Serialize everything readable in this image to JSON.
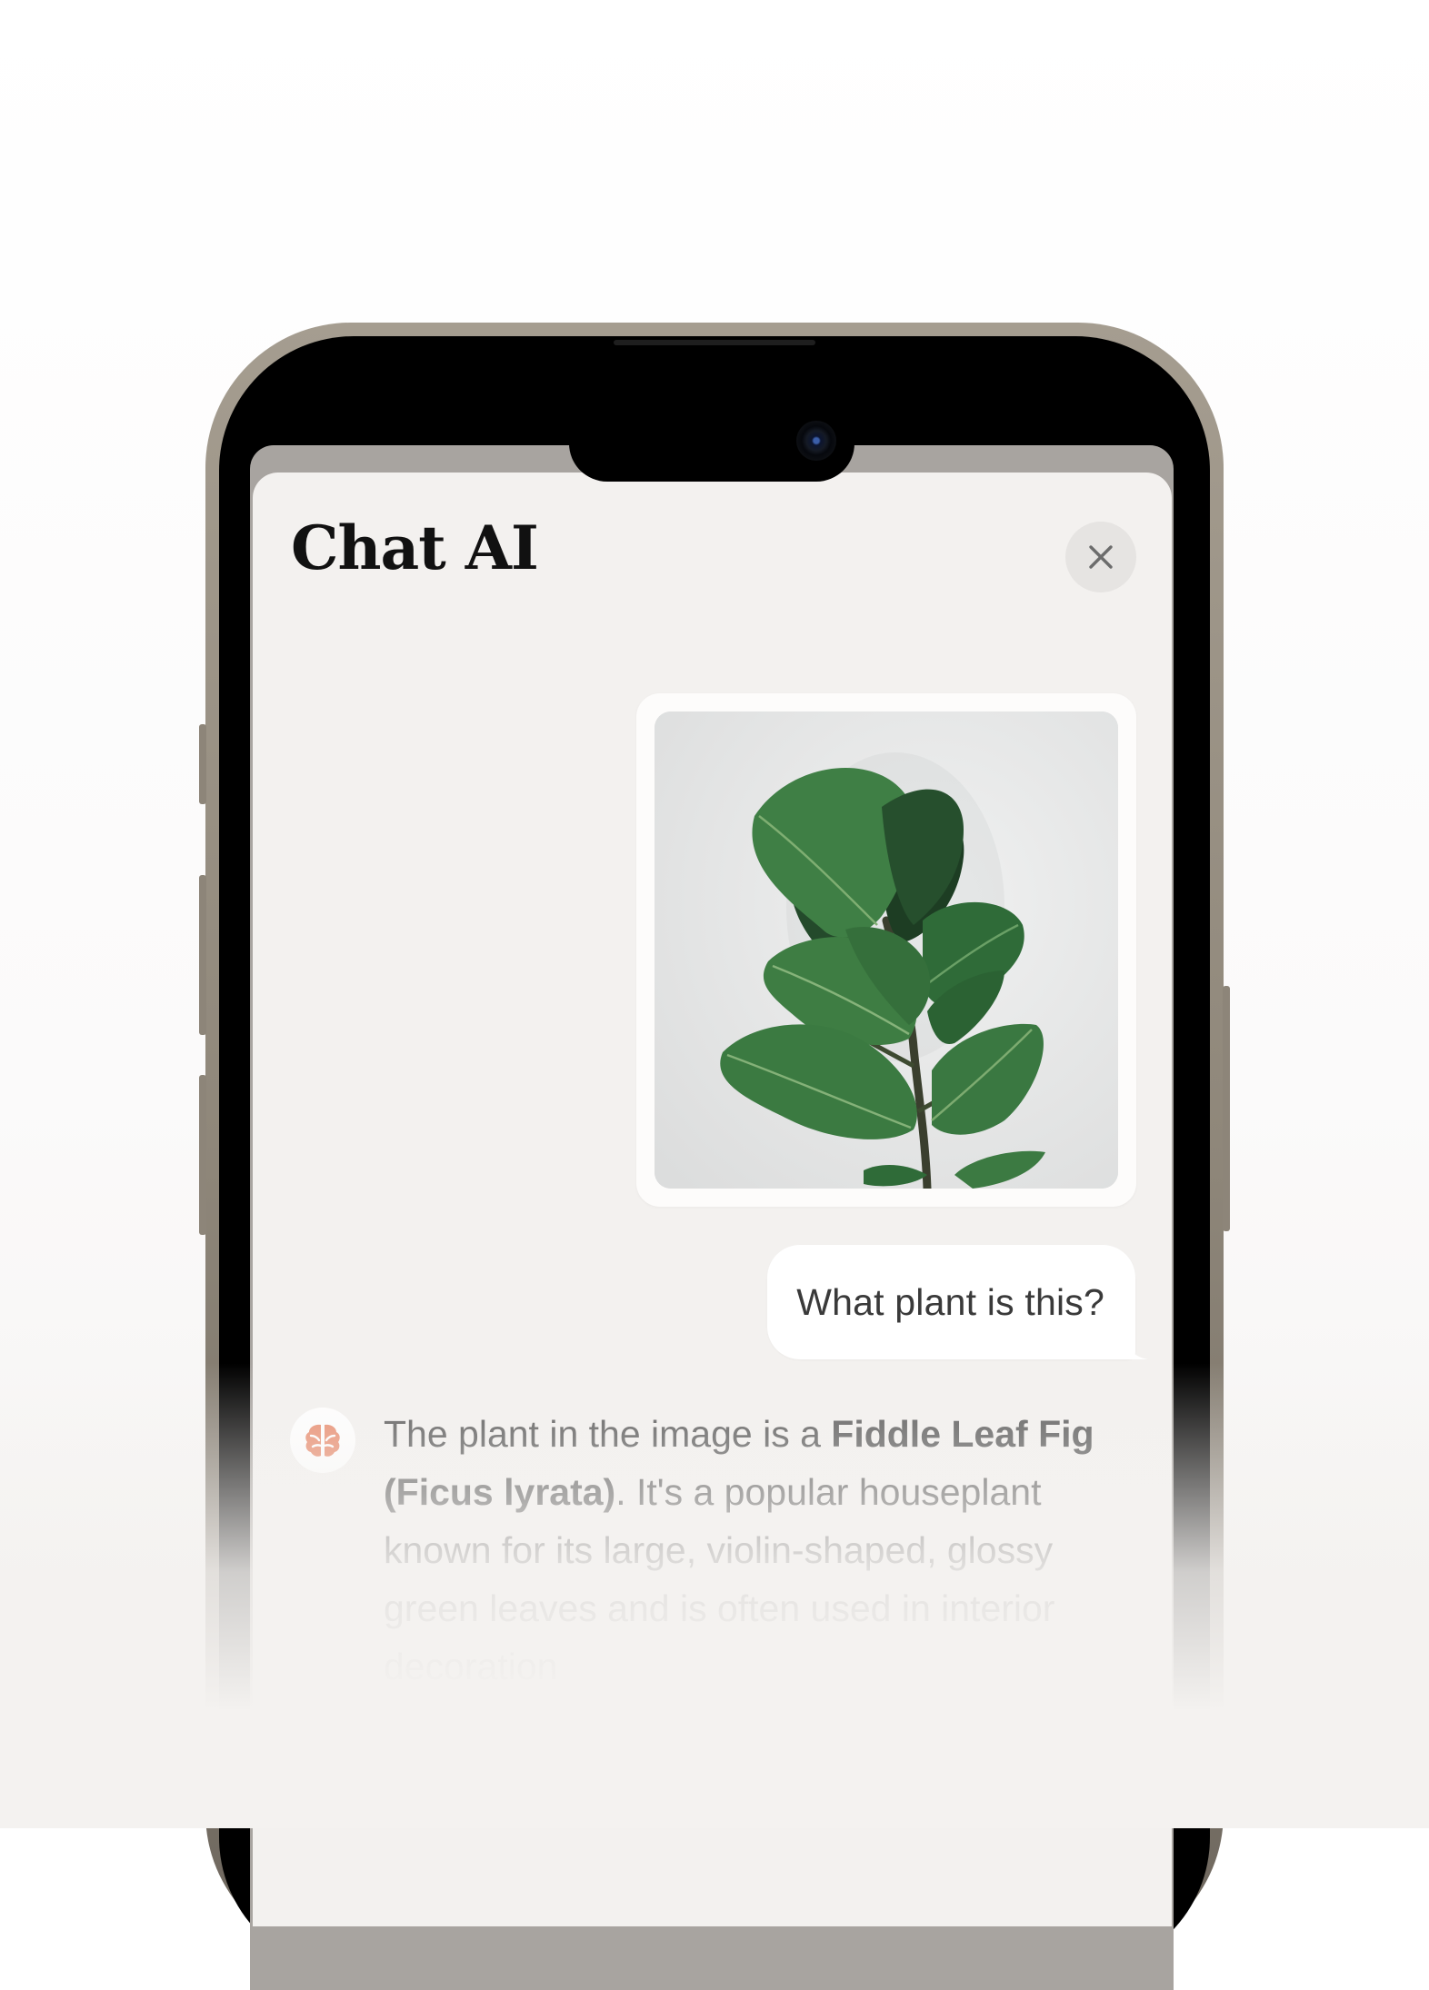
{
  "header": {
    "title": "Chat AI"
  },
  "icons": {
    "close": "close-icon",
    "assistant": "brain-icon",
    "camera": "front-camera"
  },
  "messages": [
    {
      "role": "user",
      "type": "image",
      "content": "fiddle-leaf-fig-photo"
    },
    {
      "role": "user",
      "type": "text",
      "text": "What plant is this?"
    },
    {
      "role": "assistant",
      "type": "text",
      "parts": [
        {
          "text": "The plant in the image is a "
        },
        {
          "text": "Fiddle Leaf Fig (Ficus lyrata)",
          "bold": true
        },
        {
          "text": ". It's a popular houseplant known for its large, violin-shaped, glossy green leaves and is often used in interior decoration"
        }
      ]
    }
  ],
  "colors": {
    "sheet_background": "#f3f1ef",
    "bubble_background": "#ffffff",
    "title_text": "#111111",
    "assistant_accent": "#e8896a",
    "leaf_green": "#2f6b3c"
  }
}
